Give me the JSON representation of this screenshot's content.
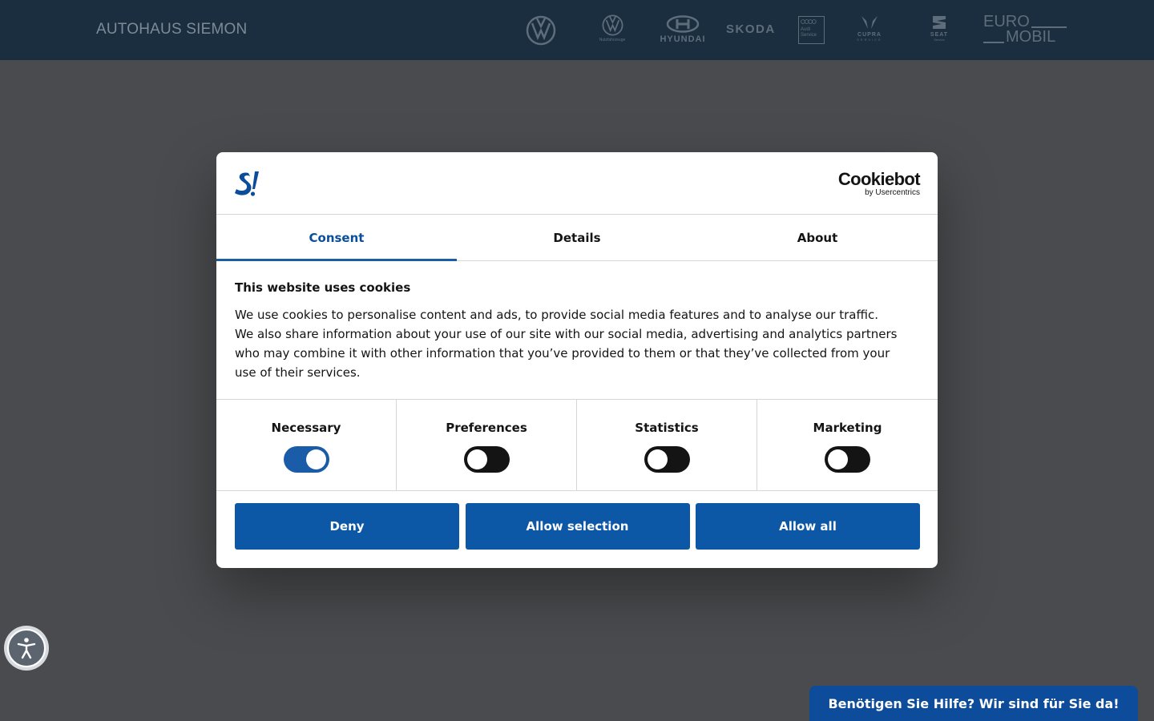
{
  "header": {
    "brand": "AUTOHAUS SIEMON",
    "logos": {
      "vw_nutzfahrzeuge_caption": "Nutzfahrzeuge",
      "hyundai": "HYUNDAI",
      "skoda": "SKODA",
      "audi_caption_1": "Audi",
      "audi_caption_2": "Service",
      "cupra_1": "CUPRA",
      "cupra_2": "SERVICE",
      "seat_1": "SEAT",
      "seat_2": "Service",
      "euromobil_1": "EURO",
      "euromobil_2": "MOBIL"
    }
  },
  "dialog": {
    "provider_name": "Cookiebot",
    "provider_sub": "by Usercentrics",
    "tabs": [
      {
        "label": "Consent",
        "active": true
      },
      {
        "label": "Details",
        "active": false
      },
      {
        "label": "About",
        "active": false
      }
    ],
    "title": "This website uses cookies",
    "text": "We use cookies to personalise content and ads, to provide social media features and to analyse our traffic. We also share information about your use of our site with our social media, advertising and analytics partners who may combine it with other information that you’ve provided to them or that they’ve collected from your use of their services.",
    "categories": [
      {
        "label": "Necessary",
        "checked": true
      },
      {
        "label": "Preferences",
        "checked": false
      },
      {
        "label": "Statistics",
        "checked": false
      },
      {
        "label": "Marketing",
        "checked": false
      }
    ],
    "buttons": {
      "deny": "Deny",
      "allow_selection": "Allow selection",
      "allow_all": "Allow all"
    }
  },
  "help_button": "Benötigen Sie Hilfe? Wir sind für Sie da!",
  "colors": {
    "accent": "#0d58a6",
    "header_bg": "#1b2e3f",
    "overlay": "#4a4b4e"
  },
  "icons": {
    "accessibility": "accessibility-icon",
    "dealer_logo": "s-logo"
  }
}
